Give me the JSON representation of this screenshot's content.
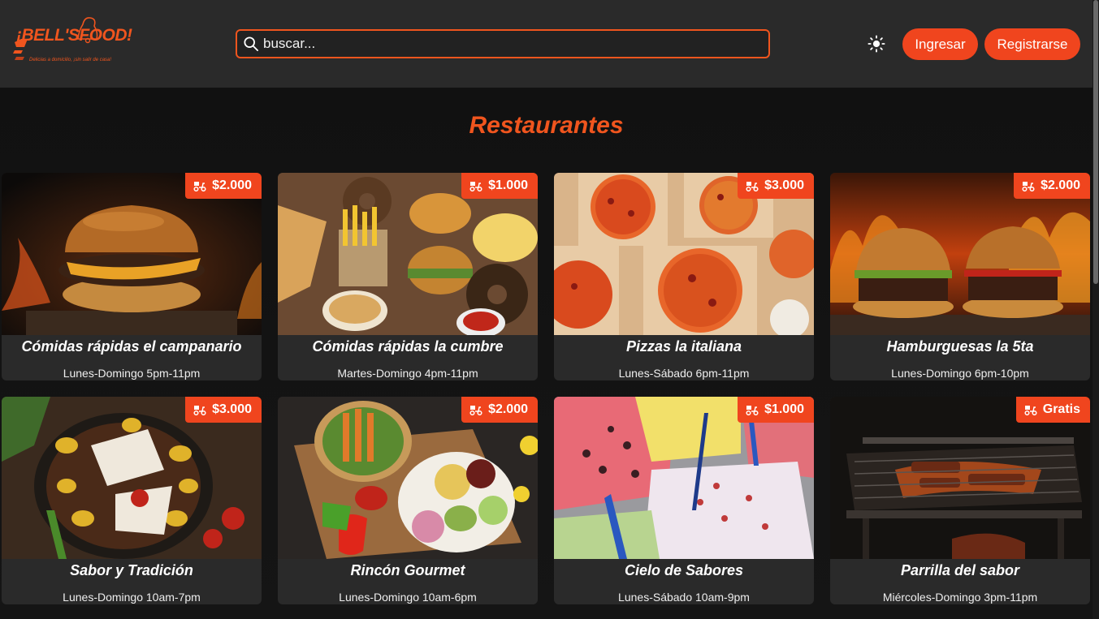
{
  "header": {
    "logo_title": "¡BELL'SFOOD!",
    "logo_subtitle": "Delicias a domicilio, ¡sin salir de casa!",
    "search_placeholder": "buscar...",
    "login_label": "Ingresar",
    "register_label": "Registrarse"
  },
  "main": {
    "title": "Restaurantes",
    "restaurants": [
      {
        "name": "Cómidas rápidas el campanario",
        "hours": "Lunes-Domingo 5pm-11pm",
        "delivery": "$2.000"
      },
      {
        "name": "Cómidas rápidas la cumbre",
        "hours": "Martes-Domingo 4pm-11pm",
        "delivery": "$1.000"
      },
      {
        "name": "Pizzas la italiana",
        "hours": "Lunes-Sábado 6pm-11pm",
        "delivery": "$3.000"
      },
      {
        "name": "Hamburguesas la 5ta",
        "hours": "Lunes-Domingo 6pm-10pm",
        "delivery": "$2.000"
      },
      {
        "name": "Sabor y Tradición",
        "hours": "Lunes-Domingo 10am-7pm",
        "delivery": "$3.000"
      },
      {
        "name": "Rincón Gourmet",
        "hours": "Lunes-Domingo 10am-6pm",
        "delivery": "$2.000"
      },
      {
        "name": "Cielo de Sabores",
        "hours": "Lunes-Sábado 10am-9pm",
        "delivery": "$1.000"
      },
      {
        "name": "Parrilla del sabor",
        "hours": "Miércoles-Domingo 3pm-11pm",
        "delivery": "Gratis"
      }
    ]
  },
  "colors": {
    "accent": "#f0451e",
    "header_bg": "#2a2a2a",
    "card_bg": "#2a2a2a"
  },
  "icons": {
    "search": "search-icon",
    "theme": "sun-icon",
    "delivery": "delivery-moto-icon",
    "logo": "bell-icon"
  }
}
